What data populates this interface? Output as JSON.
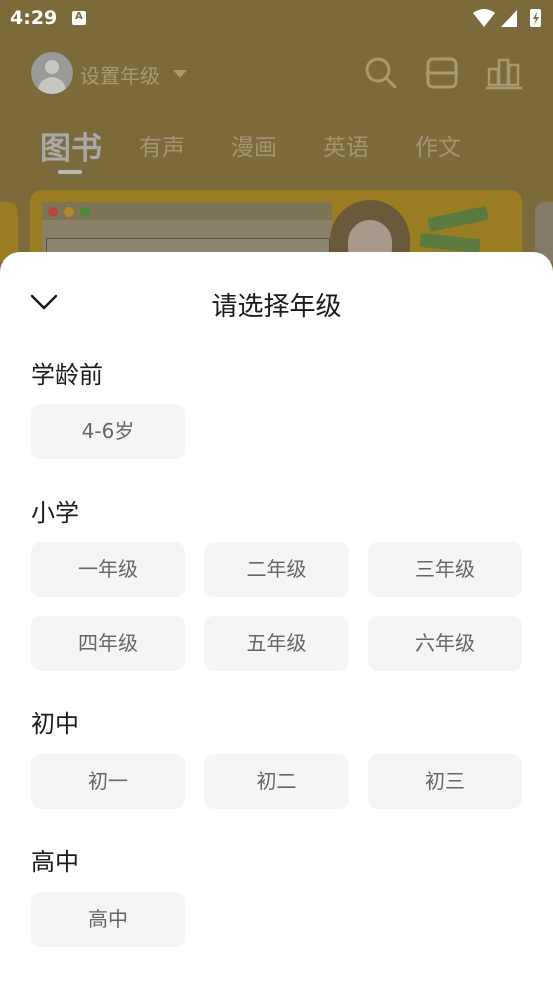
{
  "status_bar": {
    "time": "4:29"
  },
  "header": {
    "grade_setting": "设置年级"
  },
  "tabs": [
    {
      "label": "图书"
    },
    {
      "label": "有声"
    },
    {
      "label": "漫画"
    },
    {
      "label": "英语"
    },
    {
      "label": "作文"
    }
  ],
  "sheet": {
    "title": "请选择年级",
    "sections": [
      {
        "title": "学龄前",
        "options": [
          "4-6岁"
        ]
      },
      {
        "title": "小学",
        "options": [
          "一年级",
          "二年级",
          "三年级",
          "四年级",
          "五年级",
          "六年级"
        ]
      },
      {
        "title": "初中",
        "options": [
          "初一",
          "初二",
          "初三"
        ]
      },
      {
        "title": "高中",
        "options": [
          "高中"
        ]
      }
    ]
  },
  "colors": {
    "overlay_background": "#7d6a3a",
    "sheet_background": "#ffffff",
    "option_background": "#f5f5f5",
    "option_text": "#666666"
  }
}
